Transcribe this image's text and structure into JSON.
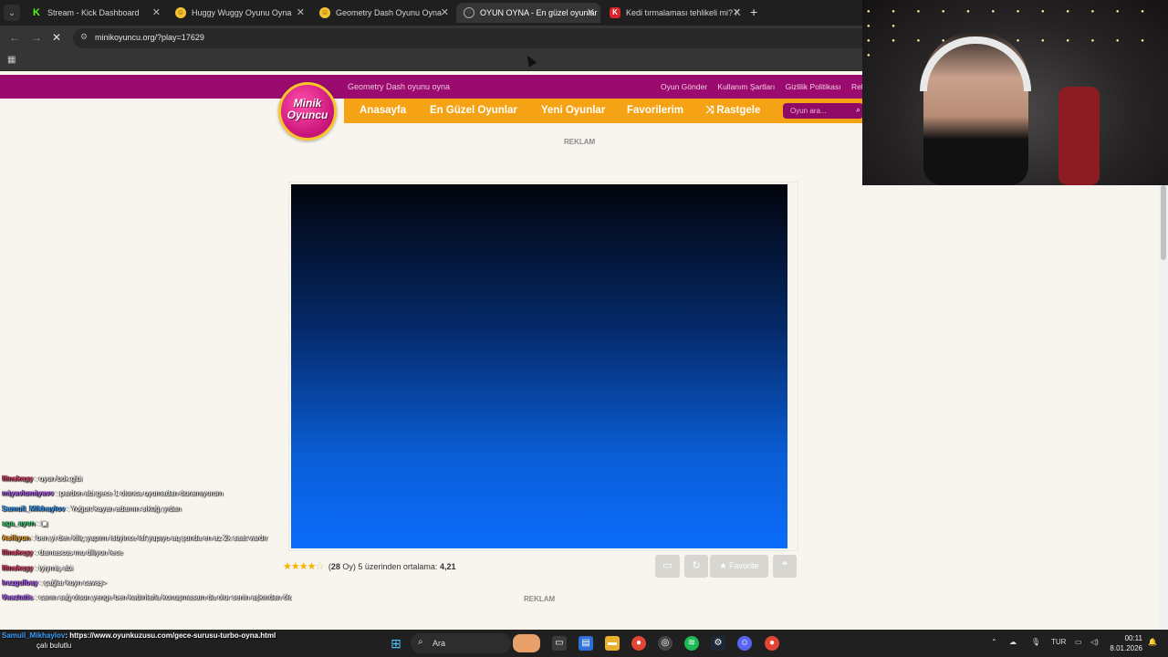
{
  "browser": {
    "tabs": [
      {
        "title": "Stream - Kick Dashboard",
        "icon": "kick-icon",
        "active": false
      },
      {
        "title": "Huggy Wuggy Oyunu Oyna",
        "icon": "smiley-icon",
        "active": false
      },
      {
        "title": "Geometry Dash Oyunu Oyna",
        "icon": "smiley-icon",
        "active": false
      },
      {
        "title": "OYUN OYNA - En güzel oyunlar",
        "icon": "globe-icon",
        "active": true
      },
      {
        "title": "Kedi tırmalaması tehlikeli mi? K",
        "icon": "k-icon",
        "active": false
      }
    ],
    "url": "minikoyuncu.org/?play=17629"
  },
  "site": {
    "subtitle": "Geometry Dash oyunu oyna",
    "top_links": [
      "Oyun Gönder",
      "Kullanım Şartları",
      "Gizlilik Politikası",
      "Rek"
    ],
    "logo_line1": "Minik",
    "logo_line2": "Oyuncu",
    "nav": [
      "Anasayfa",
      "En Güzel Oyunlar",
      "Yeni Oyunlar",
      "Favorilerim",
      "Rastgele"
    ],
    "search_placeholder": "Oyun ara...",
    "ad_label": "REKLAM",
    "rating_count": "28",
    "rating_text": "Oy) 5 üzerinden ortalama:",
    "rating_value": "4,21",
    "favorite_label": "Favorite",
    "stars": 4.21
  },
  "chat": [
    {
      "user": "flinskeyy",
      "color": "#e83a66",
      "msg": ": oyun bok gibi"
    },
    {
      "user": "miyavlumiyavv",
      "color": "#b45cff",
      "msg": ": pardon abi gece 1 olunca uyumadan duramıyorum"
    },
    {
      "user": "Samuil_Mikhaylov",
      "color": "#3aa0ff",
      "msg": ": Yoğurt kayan adamın sıktığı yıdan"
    },
    {
      "user": "aga_ayen",
      "color": "#3ecf72",
      "msg": ":"
    },
    {
      "user": "Asiliyun",
      "color": "#f5a623",
      "msg": ": ben yi den kiliç yapımı istiyince laf yapıyo aq şunda en az 2k saat vardır"
    },
    {
      "user": "flinskeyy",
      "color": "#e83a66",
      "msg": ": damascus mu diliyon lece"
    },
    {
      "user": "flinskeyy",
      "color": "#e83a66",
      "msg": ": iyiymiş abi"
    },
    {
      "user": "lrazgulbay",
      "color": "#b45cff",
      "msg": ": çağlar koyn cavaş>"
    },
    {
      "user": "Vasztatis",
      "color": "#b45cff",
      "msg": ": canın sağ olsun yenge ben kadınlarla konuşmasam da olur senin aşkından ölsem ol"
    }
  ],
  "overlay_link": {
    "user": "Samuil_Mikhaylov",
    "text": ": https://www.oyunkuzusu.com/gece-surusu-turbo-oyna.html",
    "subtext": "çalı bulutlu"
  },
  "taskbar": {
    "search": "Ara",
    "lang": "TUR",
    "time": "00:11",
    "date": "8.01.2026"
  }
}
